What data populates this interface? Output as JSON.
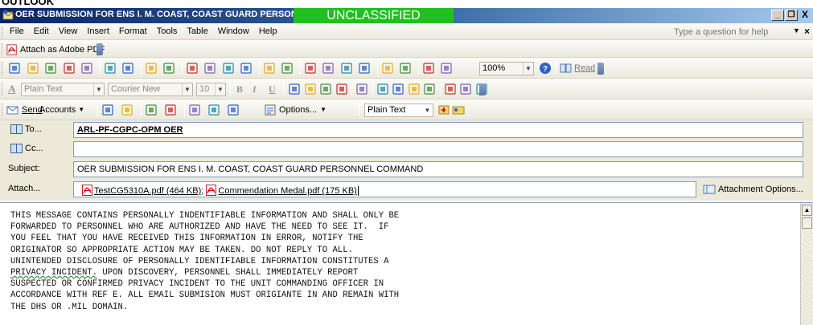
{
  "window": {
    "top_clip_text": "OUTLOOK",
    "title": "OER SUBMISSION FOR ENS I. M. COAST, COAST GUARD PERSONNEL",
    "classification_banner": "UNCLASSIFIED",
    "banner_color": "#1fc11f",
    "buttons": {
      "minimize": "_",
      "restore": "❐",
      "close": "X"
    }
  },
  "menubar": {
    "items": [
      "File",
      "Edit",
      "View",
      "Insert",
      "Format",
      "Tools",
      "Table",
      "Window",
      "Help"
    ],
    "ask_placeholder": "Type a question for help",
    "doc_close": "×"
  },
  "pdf_toolbar": {
    "attach_label": "Attach as Adobe PDF"
  },
  "standard_toolbar": {
    "icons": [
      "new-icon",
      "open-icon",
      "save-icon",
      "permission-icon",
      "print-preview-icon",
      "print-icon",
      "web-preview-icon",
      "spelling-icon",
      "research-icon",
      "cut-icon",
      "copy-icon",
      "paste-icon",
      "format-painter-icon",
      "undo-icon",
      "redo-icon",
      "hyperlink-icon",
      "tables-borders-icon",
      "insert-table-icon",
      "insert-excel-icon",
      "columns-icon",
      "drawing-icon",
      "document-map-icon",
      "show-formatting-icon"
    ],
    "zoom": "100%",
    "read_label": "Read"
  },
  "format_toolbar": {
    "style": "Plain Text",
    "font": "Courier New",
    "size": "10",
    "bold": "B",
    "italic": "I",
    "underline": "U"
  },
  "send_toolbar": {
    "send_label": "Send",
    "accounts_label": "Accounts",
    "options_label": "Options...",
    "format_value": "Plain Text"
  },
  "fields": {
    "to_label": "To...",
    "to_value": "ARL-PF-CGPC-OPM OER",
    "cc_label": "Cc...",
    "cc_value": "",
    "subject_label": "Subject:",
    "subject_value": "OER SUBMISSION FOR ENS I. M. COAST, COAST GUARD PERSONNEL COMMAND",
    "attach_label": "Attach...",
    "attachments": [
      {
        "name": "TestCG5310A.pdf (464 KB)",
        "separator": ";"
      },
      {
        "name": "Commendation Medal.pdf (175 KB)",
        "separator": ""
      }
    ],
    "attachment_options": "Attachment Options..."
  },
  "body": {
    "line1": "THIS MESSAGE CONTAINS PERSONALLY INDENTIFIABLE INFORMATION AND SHALL ONLY BE",
    "line2": "FORWARDED TO PERSONNEL WHO ARE AUTHORIZED AND HAVE THE NEED TO SEE IT.  IF",
    "line3": "YOU FEEL THAT YOU HAVE RECEIVED THIS INFORMATION IN ERROR, NOTIFY THE",
    "line4": "ORIGINATOR SO APPROPRIATE ACTION MAY BE TAKEN. DO NOT REPLY TO ALL.",
    "line5": "UNINTENDED DISCLOSURE OF PERSONALLY IDENTIFIABLE INFORMATION CONSTITUTES A",
    "line6_underlined": "PRIVACY INCIDENT.",
    "line6_rest": " UPON DISCOVERY, PERSONNEL SHALL IMMEDIATELY REPORT",
    "line7": "SUSPECTED OR CONFIRMED PRIVACY INCIDENT TO THE UNIT COMMANDING OFFICER IN",
    "line8": "ACCORDANCE WITH REF E. ALL EMAIL SUBMISION MUST ORIGIANTE IN AND REMAIN WITH",
    "line9": "THE DHS OR .MIL DOMAIN."
  }
}
